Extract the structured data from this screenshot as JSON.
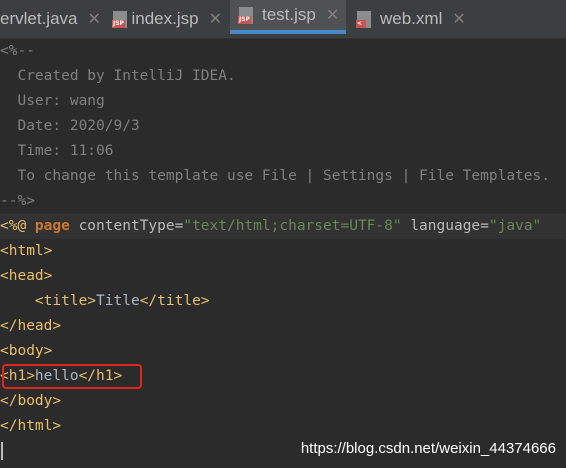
{
  "tabs": [
    {
      "label": "ervlet.java",
      "icon": "java-file-icon",
      "active": false
    },
    {
      "label": "index.jsp",
      "icon": "jsp-file-icon",
      "badge": "JSP",
      "active": false
    },
    {
      "label": "test.jsp",
      "icon": "jsp-file-icon",
      "badge": "JSP",
      "active": true
    },
    {
      "label": "web.xml",
      "icon": "xml-file-icon",
      "badge": "<",
      "active": false
    }
  ],
  "close_glyph": "✕",
  "code": {
    "l1": "<%--",
    "l2": "  Created by IntelliJ IDEA.",
    "l3": "  User: wang",
    "l4": "  Date: 2020/9/3",
    "l5": "  Time: 11:06",
    "l6": "  To change this template use File | Settings | File Templates.",
    "l7": "--%>",
    "l8": {
      "open": "<%@ ",
      "kw": "page",
      "a1": " contentType=",
      "v1": "\"text/html;charset=UTF-8\"",
      "a2": " language=",
      "v2": "\"java\""
    },
    "l9": "<html>",
    "l10": "<head>",
    "l11": {
      "indent": "    ",
      "open": "<title>",
      "text": "Title",
      "close": "</title>"
    },
    "l12": "</head>",
    "l13": "<body>",
    "l14": {
      "open": "<h1>",
      "text": "hello",
      "close": "</h1>"
    },
    "l15": "</body>",
    "l16": "</html>"
  },
  "watermark": "https://blog.csdn.net/weixin_44374666",
  "colors": {
    "highlight_box": "#e0241e",
    "active_tab_underline": "#4a88c7"
  }
}
